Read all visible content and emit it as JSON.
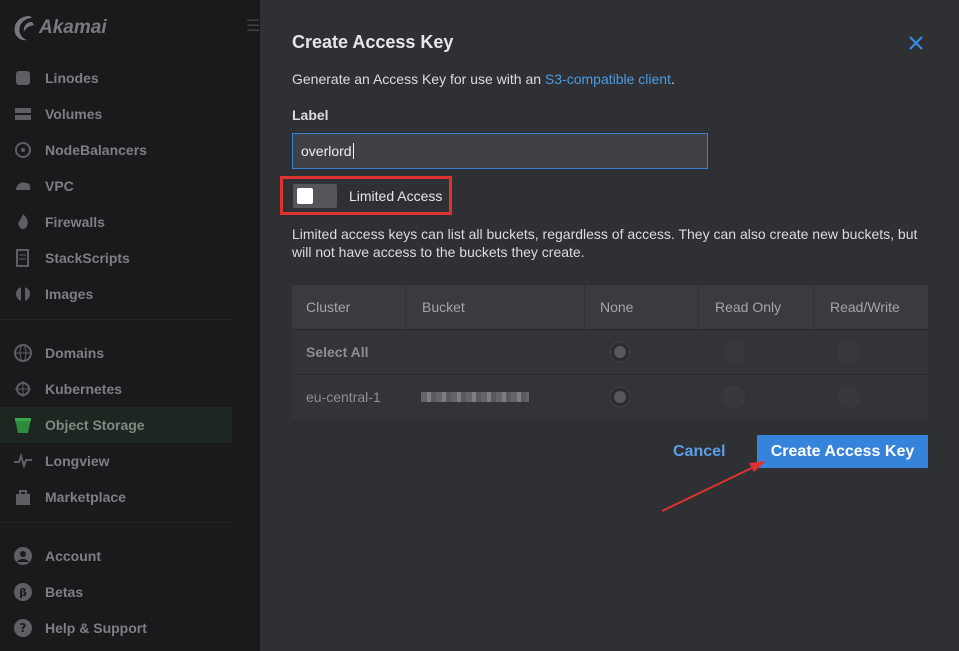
{
  "brand": {
    "logo_text": "Akamai"
  },
  "sidebar": {
    "items": [
      {
        "label": "Linodes",
        "icon": "linode-icon"
      },
      {
        "label": "Volumes",
        "icon": "volume-icon"
      },
      {
        "label": "NodeBalancers",
        "icon": "nodebalancer-icon"
      },
      {
        "label": "VPC",
        "icon": "vpc-icon"
      },
      {
        "label": "Firewalls",
        "icon": "firewall-icon"
      },
      {
        "label": "StackScripts",
        "icon": "stackscript-icon"
      },
      {
        "label": "Images",
        "icon": "image-icon"
      },
      {
        "label": "Domains",
        "icon": "globe-icon"
      },
      {
        "label": "Kubernetes",
        "icon": "kubernetes-icon"
      },
      {
        "label": "Object Storage",
        "icon": "bucket-icon"
      },
      {
        "label": "Longview",
        "icon": "longview-icon"
      },
      {
        "label": "Marketplace",
        "icon": "marketplace-icon"
      },
      {
        "label": "Account",
        "icon": "account-icon"
      },
      {
        "label": "Betas",
        "icon": "beta-icon"
      },
      {
        "label": "Help & Support",
        "icon": "help-icon"
      }
    ],
    "active": "Object Storage"
  },
  "dialog": {
    "title": "Create Access Key",
    "description_prefix": "Generate an Access Key for use with an ",
    "description_link": "S3-compatible client",
    "description_suffix": ".",
    "label": "Label",
    "label_value": "overlord",
    "toggle_label": "Limited Access",
    "toggle_on": false,
    "note": "Limited access keys can list all buckets, regardless of access. They can also create new buckets, but will not have access to the buckets they create.",
    "table": {
      "headers": [
        "Cluster",
        "Bucket",
        "None",
        "Read Only",
        "Read/Write"
      ],
      "rows": [
        {
          "cluster": "Select All",
          "bucket": "",
          "selected": "None"
        },
        {
          "cluster": "eu-central-1",
          "bucket": "",
          "selected": "None"
        }
      ]
    },
    "cancel_label": "Cancel",
    "submit_label": "Create Access Key"
  },
  "colors": {
    "accent": "#3683dc",
    "link": "#4d9ae6",
    "highlight": "#e03131",
    "dialog_bg": "#2f3033"
  }
}
